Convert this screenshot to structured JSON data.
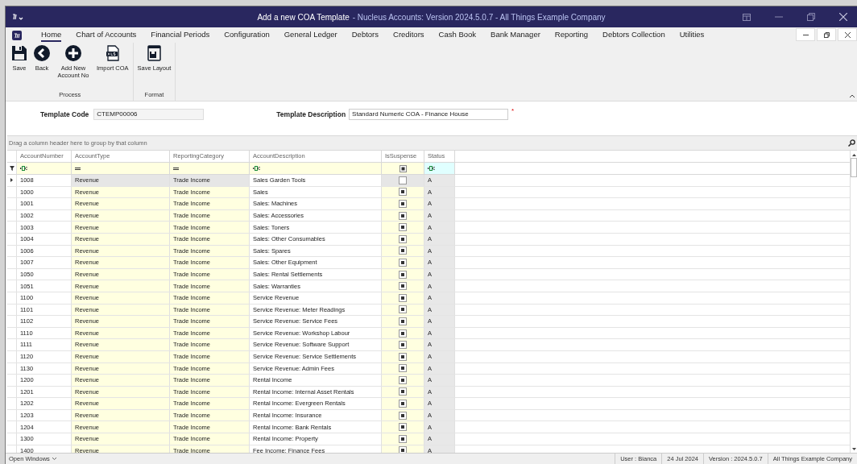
{
  "window": {
    "title": "Add a new COA Template",
    "subtitle": "- Nucleus Accounts: Version 2024.5.0.7 - All Things Example Company"
  },
  "menu": [
    {
      "label": "Home",
      "selected": true
    },
    {
      "label": "Chart of Accounts",
      "selected": false
    },
    {
      "label": "Financial Periods",
      "selected": false
    },
    {
      "label": "Configuration",
      "selected": false
    },
    {
      "label": "General Ledger",
      "selected": false
    },
    {
      "label": "Debtors",
      "selected": false
    },
    {
      "label": "Creditors",
      "selected": false
    },
    {
      "label": "Cash Book",
      "selected": false
    },
    {
      "label": "Bank Manager",
      "selected": false
    },
    {
      "label": "Reporting",
      "selected": false
    },
    {
      "label": "Debtors Collection",
      "selected": false
    },
    {
      "label": "Utilities",
      "selected": false
    }
  ],
  "ribbon": [
    {
      "label": "Process",
      "buttons": [
        {
          "kind": "save",
          "label": "Save"
        },
        {
          "kind": "back",
          "label": "Back"
        },
        {
          "kind": "add",
          "label": "Add New Account No"
        },
        {
          "kind": "xls",
          "label": "Import COA"
        }
      ]
    },
    {
      "label": "Format",
      "buttons": [
        {
          "kind": "layout",
          "label": "Save Layout"
        }
      ]
    }
  ],
  "form": {
    "code_label": "Template Code",
    "code_value": "CTEMP00006",
    "desc_label": "Template Description",
    "desc_value": "Standard Numeric COA - Finance House",
    "required_mark": "*"
  },
  "grid": {
    "group_hint": "Drag a column header here to group by that column",
    "columns": [
      "AccountNumber",
      "AccountType",
      "ReportingCategory",
      "AccountDescription",
      "IsSuspense",
      "Status"
    ],
    "rows": [
      {
        "number": "1008",
        "type": "Revenue",
        "category": "Trade Income",
        "description": "Sales Garden Tools",
        "suspense": false,
        "status": "A",
        "selected": true
      },
      {
        "number": "1000",
        "type": "Revenue",
        "category": "Trade Income",
        "description": "Sales",
        "suspense": true,
        "status": "A",
        "selected": false
      },
      {
        "number": "1001",
        "type": "Revenue",
        "category": "Trade Income",
        "description": "Sales: Machines",
        "suspense": true,
        "status": "A",
        "selected": false
      },
      {
        "number": "1002",
        "type": "Revenue",
        "category": "Trade Income",
        "description": "Sales: Accessories",
        "suspense": true,
        "status": "A",
        "selected": false
      },
      {
        "number": "1003",
        "type": "Revenue",
        "category": "Trade Income",
        "description": "Sales: Toners",
        "suspense": true,
        "status": "A",
        "selected": false
      },
      {
        "number": "1004",
        "type": "Revenue",
        "category": "Trade Income",
        "description": "Sales: Other Consumables",
        "suspense": true,
        "status": "A",
        "selected": false
      },
      {
        "number": "1006",
        "type": "Revenue",
        "category": "Trade Income",
        "description": "Sales: Spares",
        "suspense": true,
        "status": "A",
        "selected": false
      },
      {
        "number": "1007",
        "type": "Revenue",
        "category": "Trade Income",
        "description": "Sales: Other Equipment",
        "suspense": true,
        "status": "A",
        "selected": false
      },
      {
        "number": "1050",
        "type": "Revenue",
        "category": "Trade Income",
        "description": "Sales: Rental Settlements",
        "suspense": true,
        "status": "A",
        "selected": false
      },
      {
        "number": "1051",
        "type": "Revenue",
        "category": "Trade Income",
        "description": "Sales: Warranties",
        "suspense": true,
        "status": "A",
        "selected": false
      },
      {
        "number": "1100",
        "type": "Revenue",
        "category": "Trade Income",
        "description": "Service Revenue",
        "suspense": true,
        "status": "A",
        "selected": false
      },
      {
        "number": "1101",
        "type": "Revenue",
        "category": "Trade Income",
        "description": "Service Revenue: Meter Readings",
        "suspense": true,
        "status": "A",
        "selected": false
      },
      {
        "number": "1102",
        "type": "Revenue",
        "category": "Trade Income",
        "description": "Service Revenue: Service Fees",
        "suspense": true,
        "status": "A",
        "selected": false
      },
      {
        "number": "1110",
        "type": "Revenue",
        "category": "Trade Income",
        "description": "Service Revenue: Workshop Labour",
        "suspense": true,
        "status": "A",
        "selected": false
      },
      {
        "number": "1111",
        "type": "Revenue",
        "category": "Trade Income",
        "description": "Service Revenue: Software Support",
        "suspense": true,
        "status": "A",
        "selected": false
      },
      {
        "number": "1120",
        "type": "Revenue",
        "category": "Trade Income",
        "description": "Service Revenue: Service Settlements",
        "suspense": true,
        "status": "A",
        "selected": false
      },
      {
        "number": "1130",
        "type": "Revenue",
        "category": "Trade Income",
        "description": "Service Revenue: Admin Fees",
        "suspense": true,
        "status": "A",
        "selected": false
      },
      {
        "number": "1200",
        "type": "Revenue",
        "category": "Trade Income",
        "description": "Rental Income",
        "suspense": true,
        "status": "A",
        "selected": false
      },
      {
        "number": "1201",
        "type": "Revenue",
        "category": "Trade Income",
        "description": "Rental Income: Internal Asset Rentals",
        "suspense": true,
        "status": "A",
        "selected": false
      },
      {
        "number": "1202",
        "type": "Revenue",
        "category": "Trade Income",
        "description": "Rental Income: Evergreen Rentals",
        "suspense": true,
        "status": "A",
        "selected": false
      },
      {
        "number": "1203",
        "type": "Revenue",
        "category": "Trade Income",
        "description": "Rental Income: Insurance",
        "suspense": true,
        "status": "A",
        "selected": false
      },
      {
        "number": "1204",
        "type": "Revenue",
        "category": "Trade Income",
        "description": "Rental Income: Bank Rentals",
        "suspense": true,
        "status": "A",
        "selected": false
      },
      {
        "number": "1300",
        "type": "Revenue",
        "category": "Trade Income",
        "description": "Rental Income: Property",
        "suspense": true,
        "status": "A",
        "selected": false
      },
      {
        "number": "1400",
        "type": "Revenue",
        "category": "Trade Income",
        "description": "Fee Income: Finance Fees",
        "suspense": true,
        "status": "A",
        "selected": false
      }
    ]
  },
  "status_bar": {
    "open_windows": "Open Windows",
    "items": [
      "User : Bianca",
      "24 Jul 2024",
      "Version : 2024.5.0.7",
      "All Things Example Company"
    ]
  }
}
